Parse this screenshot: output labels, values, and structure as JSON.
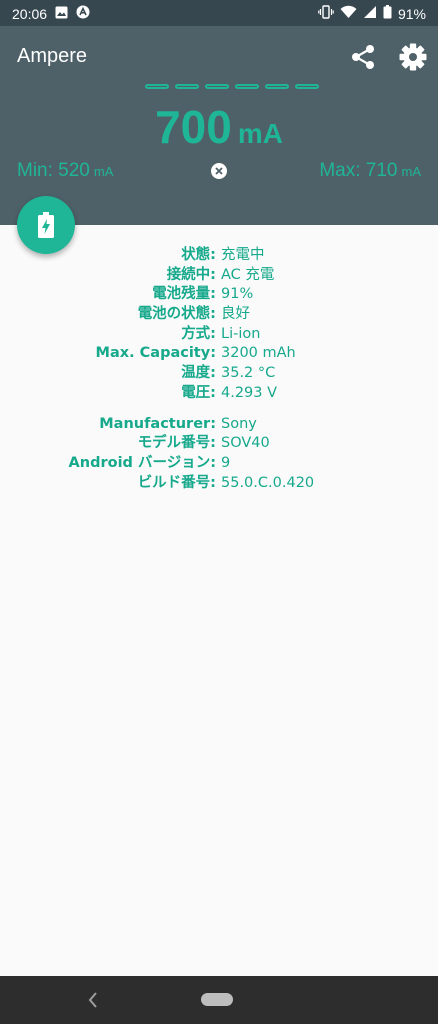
{
  "status_bar": {
    "time": "20:06",
    "battery_percent": "91%"
  },
  "app": {
    "title": "Ampere"
  },
  "meter": {
    "current_value": "700",
    "current_unit": "mA",
    "min_label": "Min: 520",
    "min_unit": "mA",
    "max_label": "Max: 710",
    "max_unit": "mA",
    "accent_color": "#1fb597"
  },
  "battery_info": [
    {
      "key": "状態:",
      "value": "充電中"
    },
    {
      "key": "接続中:",
      "value": "AC 充電"
    },
    {
      "key": "電池残量:",
      "value": "91%"
    },
    {
      "key": "電池の状態:",
      "value": "良好"
    },
    {
      "key": "方式:",
      "value": "Li-ion"
    },
    {
      "key": "Max. Capacity:",
      "value": "3200 mAh"
    },
    {
      "key": "温度:",
      "value": "35.2 °C"
    },
    {
      "key": "電圧:",
      "value": "4.293 V"
    }
  ],
  "device_info": [
    {
      "key": "Manufacturer:",
      "value": "Sony"
    },
    {
      "key": "モデル番号:",
      "value": "SOV40"
    },
    {
      "key": "Android バージョン:",
      "value": "9"
    },
    {
      "key": "ビルド番号:",
      "value": "55.0.C.0.420"
    }
  ],
  "icons": {
    "share": "share-icon",
    "settings": "gear-icon",
    "fab": "battery-charging-icon",
    "reset": "close-circle-icon"
  }
}
